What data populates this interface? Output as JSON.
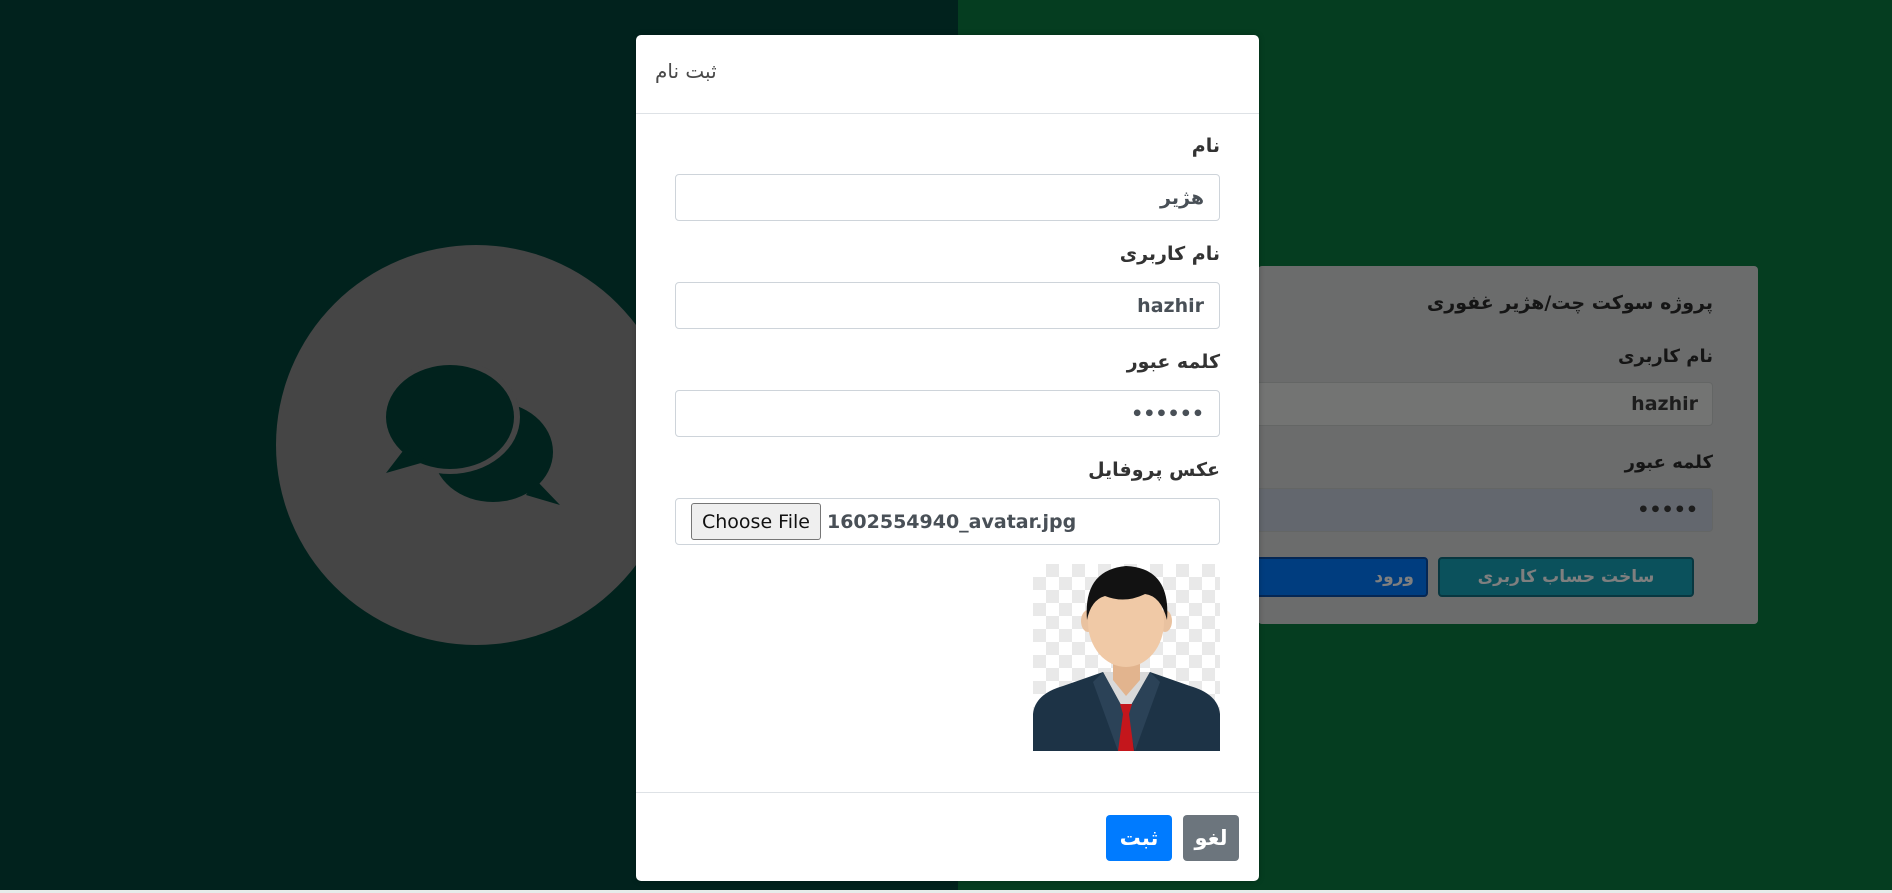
{
  "background_page": {
    "login_card": {
      "title": "پروژه سوکت چت/هژیر غفوری",
      "username_label": "نام کاربری",
      "username_value": "hazhir",
      "password_label": "کلمه عبور",
      "password_value": "•••••",
      "create_account_label": "ساخت حساب کاربری",
      "login_label": "ورود"
    },
    "logo_icon": "chat-bubbles-icon"
  },
  "modal": {
    "title": "ثبت نام",
    "fields": {
      "name": {
        "label": "نام",
        "value": "هژیر"
      },
      "username": {
        "label": "نام کاربری",
        "value": "hazhir"
      },
      "password": {
        "label": "کلمه عبور",
        "value": "••••••"
      },
      "profile_photo": {
        "label": "عکس پروفایل",
        "button_label": "Choose File",
        "file_name": "1602554940_avatar.jpg"
      }
    },
    "preview_icon": "avatar-preview-image",
    "footer": {
      "cancel_label": "لغو",
      "submit_label": "ثبت"
    }
  },
  "colors": {
    "bg_dark_green": "#02453a",
    "bg_green": "#0a7b40",
    "primary": "#007bff",
    "secondary": "#6c757d",
    "info": "#17a2b8"
  }
}
